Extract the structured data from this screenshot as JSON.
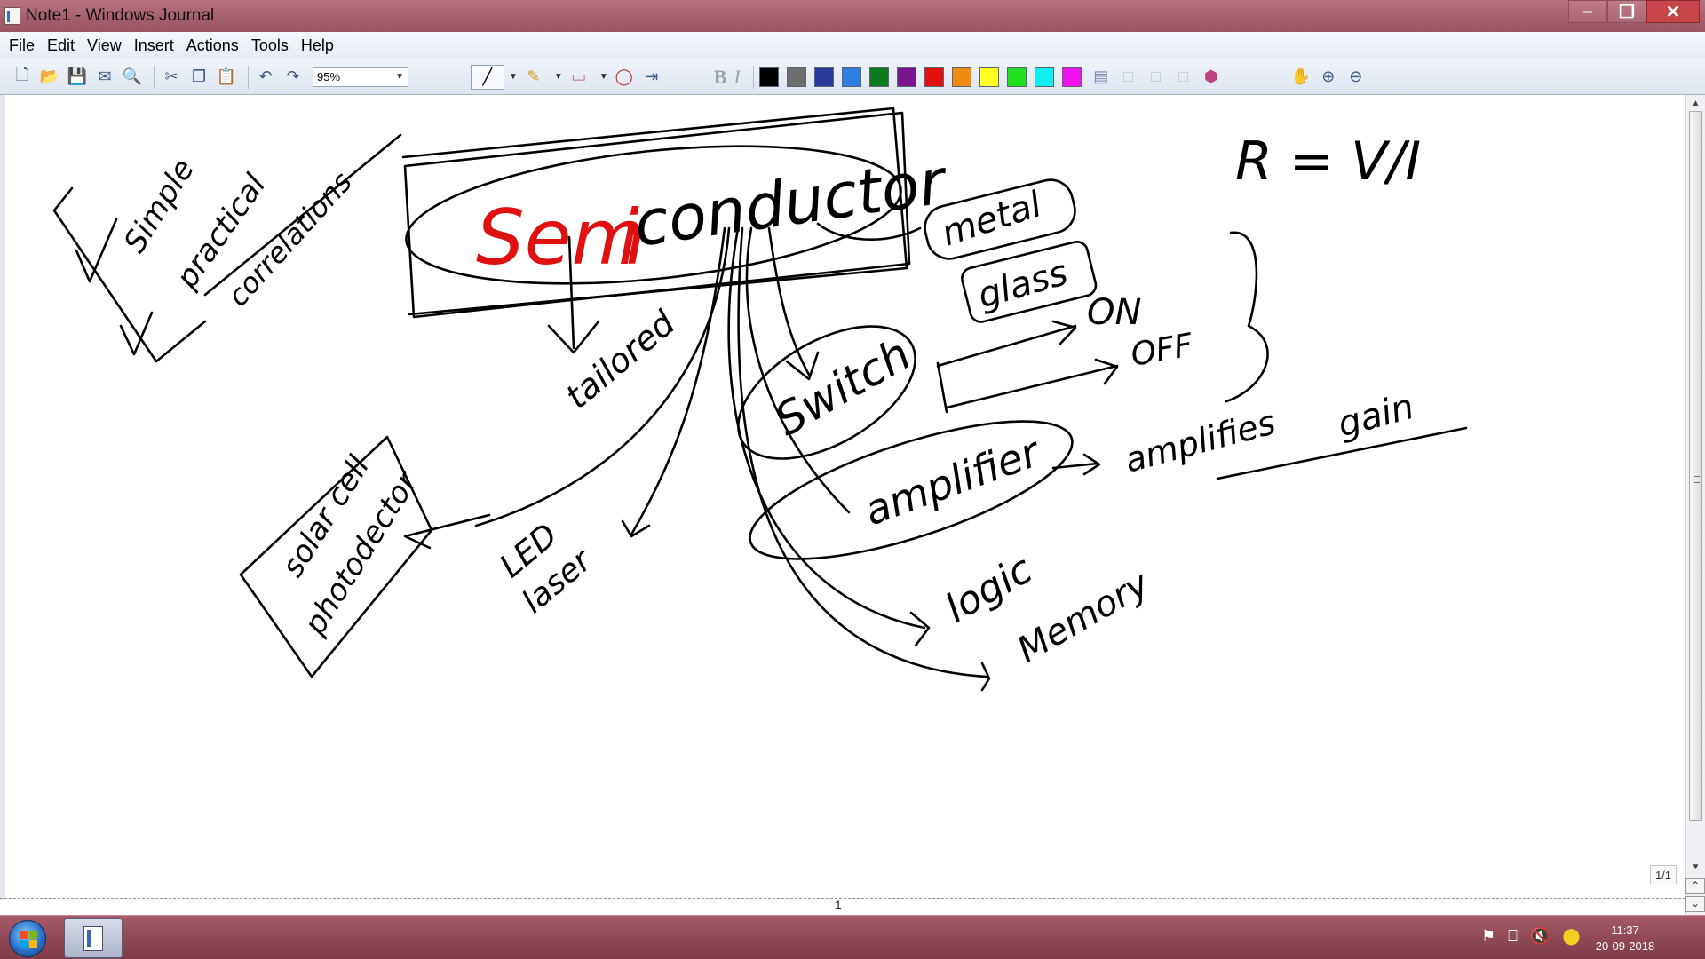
{
  "window": {
    "title": "Note1 - Windows Journal"
  },
  "menu": [
    "File",
    "Edit",
    "View",
    "Insert",
    "Actions",
    "Tools",
    "Help"
  ],
  "toolbar": {
    "zoom": "95%",
    "bold_label": "B",
    "italic_label": "I",
    "colors": [
      "#000000",
      "#6e6e6e",
      "#2a3a9a",
      "#2e7de0",
      "#0e7a1e",
      "#7a1590",
      "#e31010",
      "#f08a10",
      "#ffff20",
      "#20e020",
      "#10f0f0",
      "#f010f0"
    ]
  },
  "note": {
    "title_red": "Sem",
    "title_red2": "i",
    "title_black": "conductor",
    "formula": "R = V/I",
    "checklist": [
      "Simple",
      "practical",
      "correlations"
    ],
    "labels": {
      "tailored": "tailored",
      "metal": "metal",
      "glass": "glass",
      "switch": "Switch",
      "on": "ON",
      "off": "OFF",
      "amplifier": "amplifier",
      "amplifies": "amplifies",
      "gain": "gain",
      "solar": "solar cell",
      "photodetector": "photodector",
      "led": "LED",
      "laser": "laser",
      "logic": "logic",
      "memory": "Memory"
    }
  },
  "status": {
    "page_number": "1",
    "page_count": "1/1"
  },
  "taskbar": {
    "time": "11:37",
    "date": "20-09-2018"
  }
}
